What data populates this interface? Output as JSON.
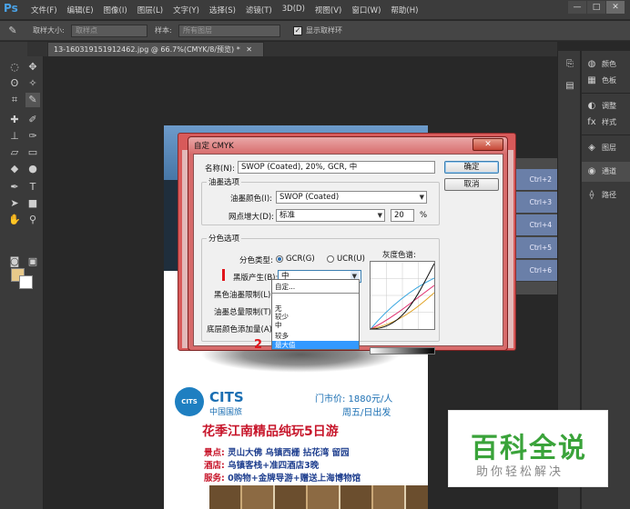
{
  "app": {
    "logo": "Ps",
    "menu": [
      "文件(F)",
      "编辑(E)",
      "图像(I)",
      "图层(L)",
      "文字(Y)",
      "选择(S)",
      "滤镜(T)",
      "3D(D)",
      "视图(V)",
      "窗口(W)",
      "帮助(H)"
    ],
    "window_controls": [
      "—",
      "□",
      "✕"
    ]
  },
  "options_bar": {
    "sample_size_label": "取样大小:",
    "sample_size_value": "取样点",
    "sample_label": "样本:",
    "sample_value": "所有图层",
    "show_ring_label": "显示取样环",
    "show_ring_checked": true
  },
  "document": {
    "tab_title": "13-1603191519124​62.jpg @ 66.7%(CMYK/8/预览) *",
    "tab_close": "✕",
    "poster": {
      "cits_badge": "CITS",
      "cits_en": "CITS",
      "cits_cn": "中国国旅",
      "price": "门市价: 1880元/人",
      "departure": "周五/日出发",
      "headline": "花季江南精品纯玩5日游",
      "lines": [
        {
          "key": "景点:",
          "value": "灵山大佛  乌镇西栅  拈花湾  留园"
        },
        {
          "key": "酒店:",
          "value": "乌镇客栈+准四酒店3晚"
        },
        {
          "key": "服务:",
          "value": "0购物+金牌导游+赠送上海博物馆"
        }
      ]
    }
  },
  "right_panels": {
    "items": [
      {
        "icon": "palette-icon",
        "glyph": "◍",
        "label": "颜色"
      },
      {
        "icon": "swatches-icon",
        "glyph": "▦",
        "label": "色板"
      },
      {
        "icon": "adjustments-icon",
        "glyph": "◐",
        "label": "调整"
      },
      {
        "icon": "styles-icon",
        "glyph": "fx",
        "label": "样式"
      },
      {
        "icon": "layers-icon",
        "glyph": "◈",
        "label": "图层"
      },
      {
        "icon": "channels-icon",
        "glyph": "◉",
        "label": "通道"
      },
      {
        "icon": "paths-icon",
        "glyph": "⟠",
        "label": "路径"
      }
    ],
    "active": "通道"
  },
  "channels": {
    "shortcuts": [
      "Ctrl+2",
      "Ctrl+3",
      "Ctrl+4",
      "Ctrl+5",
      "Ctrl+6"
    ]
  },
  "dialog": {
    "title": "自定 CMYK",
    "close": "✕",
    "name_label": "名称(N):",
    "name_value": "SWOP (Coated), 20%, GCR, 中",
    "ok": "确定",
    "cancel": "取消",
    "ink_group": "油墨选项",
    "ink_colors_label": "油墨颜色(I):",
    "ink_colors_value": "SWOP (Coated)",
    "dot_gain_label": "网点增大(D):",
    "dot_gain_value": "标准",
    "dot_gain_amount": "20",
    "dot_gain_unit": "%",
    "sep_group": "分色选项",
    "sep_type_label": "分色类型:",
    "sep_gcr": "GCR(G)",
    "sep_ucr": "UCR(U)",
    "gray_ramp_label": "灰度色谱:",
    "black_gen_label": "黑版产生(B):",
    "black_gen_value": "中",
    "black_ink_limit_label": "黑色油墨限制(L):",
    "total_ink_limit_label": "油墨总量限制(T):",
    "ucr_amount_label": "底层颜色添加量(A):",
    "dropdown_options": [
      "自定...",
      "无",
      "较少",
      "中",
      "较多",
      "最大值"
    ],
    "dropdown_selected": "最大值"
  },
  "annotation": {
    "mark_2": "2"
  },
  "watermark": {
    "big": "百科全说",
    "small": "助你轻松解决"
  },
  "colors": {
    "foreground": "#e8c98a",
    "background": "#ffffff",
    "accent_red": "#c7162b",
    "accent_blue": "#1b6fb3",
    "watermark_green": "#3aa33a"
  }
}
